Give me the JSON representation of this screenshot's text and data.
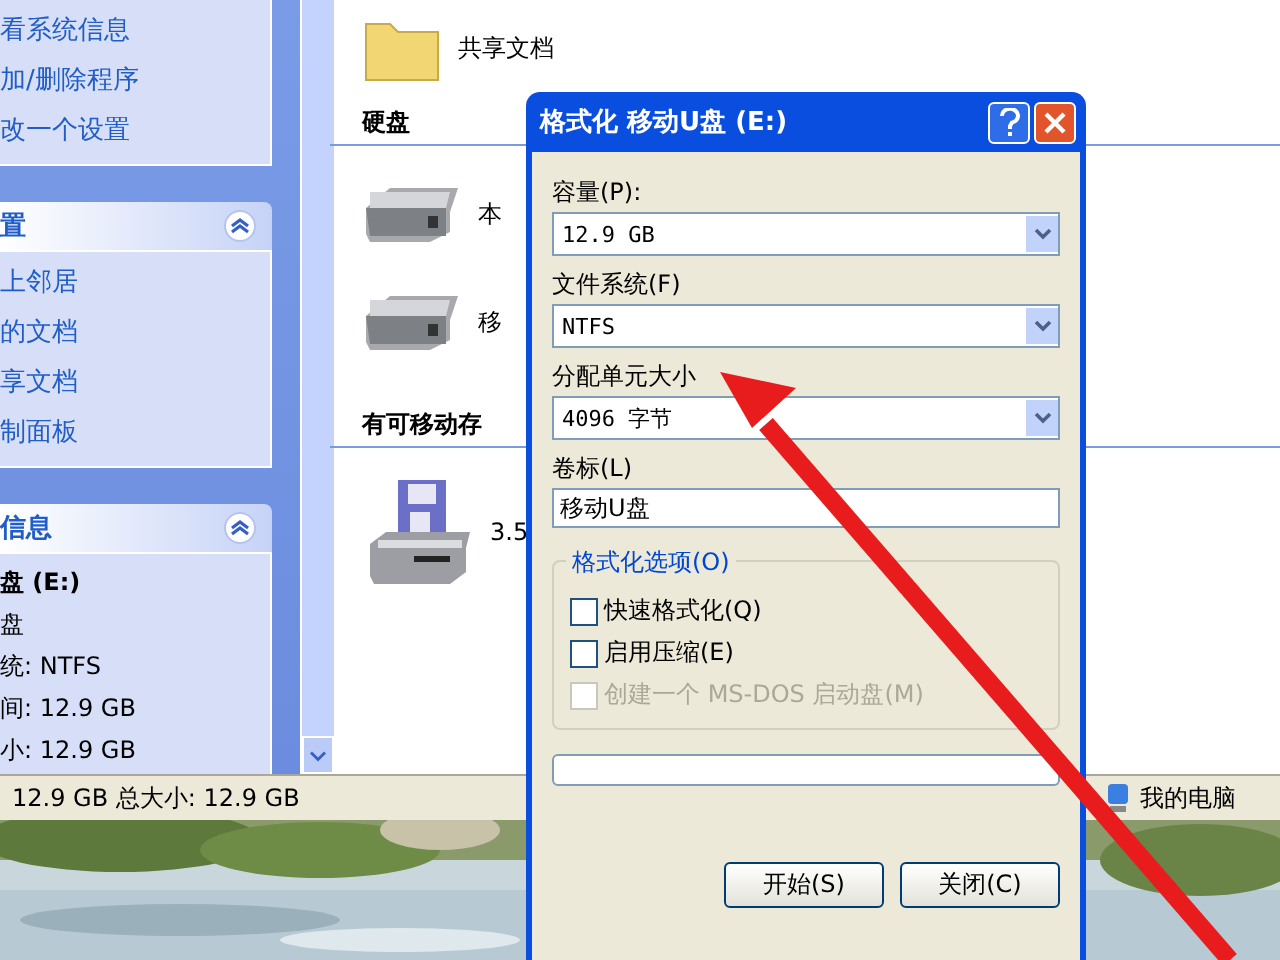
{
  "explorer": {
    "task_pane": {
      "system_tasks": [
        "看系统信息",
        "加/删除程序",
        "改一个设置"
      ],
      "places": {
        "title": "置",
        "items": [
          "上邻居",
          "的文档",
          "享文档",
          "制面板"
        ]
      },
      "details": {
        "title": "信息",
        "lines": [
          {
            "kind": "title",
            "text": "盘 (E:)"
          },
          {
            "kind": "text",
            "text": "盘"
          },
          {
            "kind": "text",
            "text": "统: NTFS"
          },
          {
            "kind": "text",
            "text": "间: 12.9 GB"
          },
          {
            "kind": "text",
            "text": "小: 12.9 GB"
          }
        ]
      }
    },
    "content": {
      "top_item": "共享文档",
      "groups": [
        {
          "title": "硬盘",
          "items": [
            {
              "kind": "disk",
              "label": "本"
            },
            {
              "kind": "disk",
              "label": "移"
            }
          ]
        },
        {
          "title": "有可移动存",
          "items": [
            {
              "kind": "floppy",
              "label": "3.5"
            }
          ]
        }
      ]
    },
    "status_bar": {
      "size_text": "12.9 GB 总大小: 12.9 GB",
      "location": "我的电脑"
    }
  },
  "dialog": {
    "title": "格式化 移动U盘 (E:)",
    "fields": [
      {
        "kind": "dropdown",
        "label": "容量(P):",
        "value": "12.9 GB"
      },
      {
        "kind": "dropdown",
        "label": "文件系统(F)",
        "value": "NTFS"
      },
      {
        "kind": "dropdown",
        "label": "分配单元大小",
        "value": "4096 字节"
      },
      {
        "kind": "text",
        "label": "卷标(L)",
        "value": "移动U盘"
      }
    ],
    "options": {
      "title": "格式化选项(O)",
      "checkboxes": [
        {
          "label": "快速格式化(Q)",
          "checked": false,
          "disabled": false
        },
        {
          "label": "启用压缩(E)",
          "checked": false,
          "disabled": false
        },
        {
          "label": "创建一个 MS-DOS 启动盘(M)",
          "checked": false,
          "disabled": true
        }
      ]
    },
    "progress": {
      "level": 0
    },
    "buttons": [
      "开始(S)",
      "关闭(C)"
    ]
  }
}
